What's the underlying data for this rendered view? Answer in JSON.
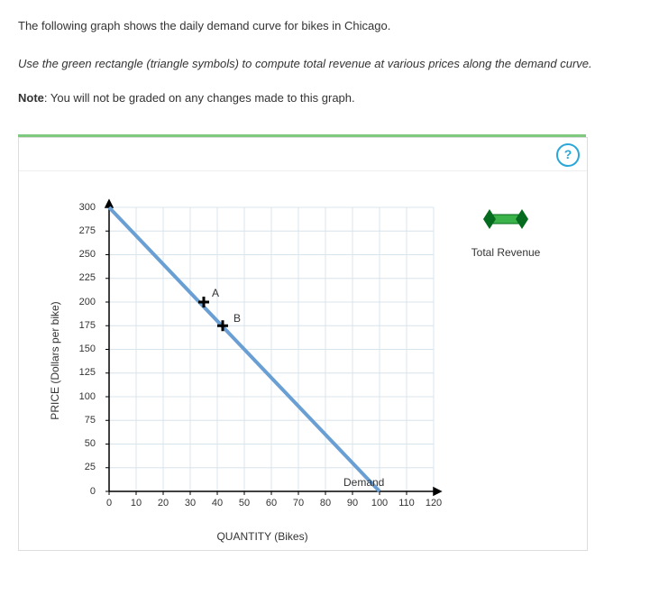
{
  "intro": {
    "line1": "The following graph shows the daily demand curve for bikes in Chicago.",
    "line2": "Use the green rectangle (triangle symbols) to compute total revenue at various prices along the demand curve.",
    "note_bold": "Note",
    "note_rest": ": You will not be graded on any changes made to this graph."
  },
  "help": "?",
  "legend": {
    "label": "Total Revenue"
  },
  "chart": {
    "ylabel": "PRICE (Dollars per bike)",
    "xlabel": "QUANTITY (Bikes)"
  },
  "labels": {
    "A": "A",
    "B": "B",
    "demand": "Demand"
  },
  "yticks": [
    "0",
    "25",
    "50",
    "75",
    "100",
    "125",
    "150",
    "175",
    "200",
    "225",
    "250",
    "275",
    "300"
  ],
  "xticks": [
    "0",
    "10",
    "20",
    "30",
    "40",
    "50",
    "60",
    "70",
    "80",
    "90",
    "100",
    "110",
    "120"
  ],
  "chart_data": {
    "type": "line",
    "title": "",
    "xlabel": "QUANTITY (Bikes)",
    "ylabel": "PRICE (Dollars per bike)",
    "xlim": [
      0,
      120
    ],
    "ylim": [
      0,
      300
    ],
    "series": [
      {
        "name": "Demand",
        "x": [
          0,
          100
        ],
        "y": [
          300,
          0
        ],
        "color": "#6a9fd4"
      }
    ],
    "points": [
      {
        "name": "A",
        "x": 35,
        "y": 200
      },
      {
        "name": "B",
        "x": 42,
        "y": 175
      }
    ],
    "tools": [
      {
        "name": "Total Revenue",
        "symbol": "triangle-rectangle",
        "color": "#3bb24a"
      }
    ],
    "grid": true,
    "legend_position": "right"
  }
}
